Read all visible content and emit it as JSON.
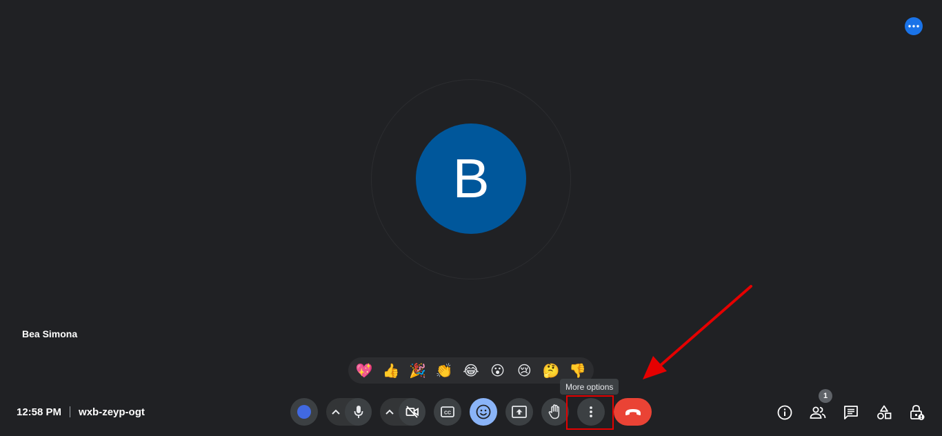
{
  "participant": {
    "initial": "B",
    "name": "Bea Simona"
  },
  "meeting": {
    "time": "12:58 PM",
    "code": "wxb-zeyp-ogt"
  },
  "reactions": [
    {
      "name": "heart-emoji",
      "glyph": "💖"
    },
    {
      "name": "thumbs-up-emoji",
      "glyph": "👍"
    },
    {
      "name": "party-popper-emoji",
      "glyph": "🎉"
    },
    {
      "name": "clapping-hands-emoji",
      "glyph": "👏"
    },
    {
      "name": "laughing-emoji",
      "glyph": "😂"
    },
    {
      "name": "surprised-emoji",
      "glyph": "😮"
    },
    {
      "name": "sad-emoji",
      "glyph": "😢"
    },
    {
      "name": "thinking-emoji",
      "glyph": "🤔"
    },
    {
      "name": "thumbs-down-emoji",
      "glyph": "👎"
    }
  ],
  "tooltip": {
    "more_options": "More options"
  },
  "people": {
    "count": "1"
  },
  "colors": {
    "background": "#202124",
    "accent_blue": "#1a73e8",
    "avatar_blue": "#00579b",
    "end_call_red": "#ea4335",
    "highlight_red": "#e50000"
  },
  "icons": {
    "top_right": "more-horizontal-icon",
    "controls": [
      "effects-dot-icon",
      "chevron-up-icon",
      "microphone-icon",
      "chevron-up-icon",
      "camera-off-icon",
      "captions-icon",
      "emoji-icon",
      "present-screen-icon",
      "raise-hand-icon",
      "more-vertical-icon",
      "end-call-icon"
    ],
    "side": [
      "info-icon",
      "people-icon",
      "chat-icon",
      "activities-icon",
      "host-controls-icon"
    ]
  }
}
